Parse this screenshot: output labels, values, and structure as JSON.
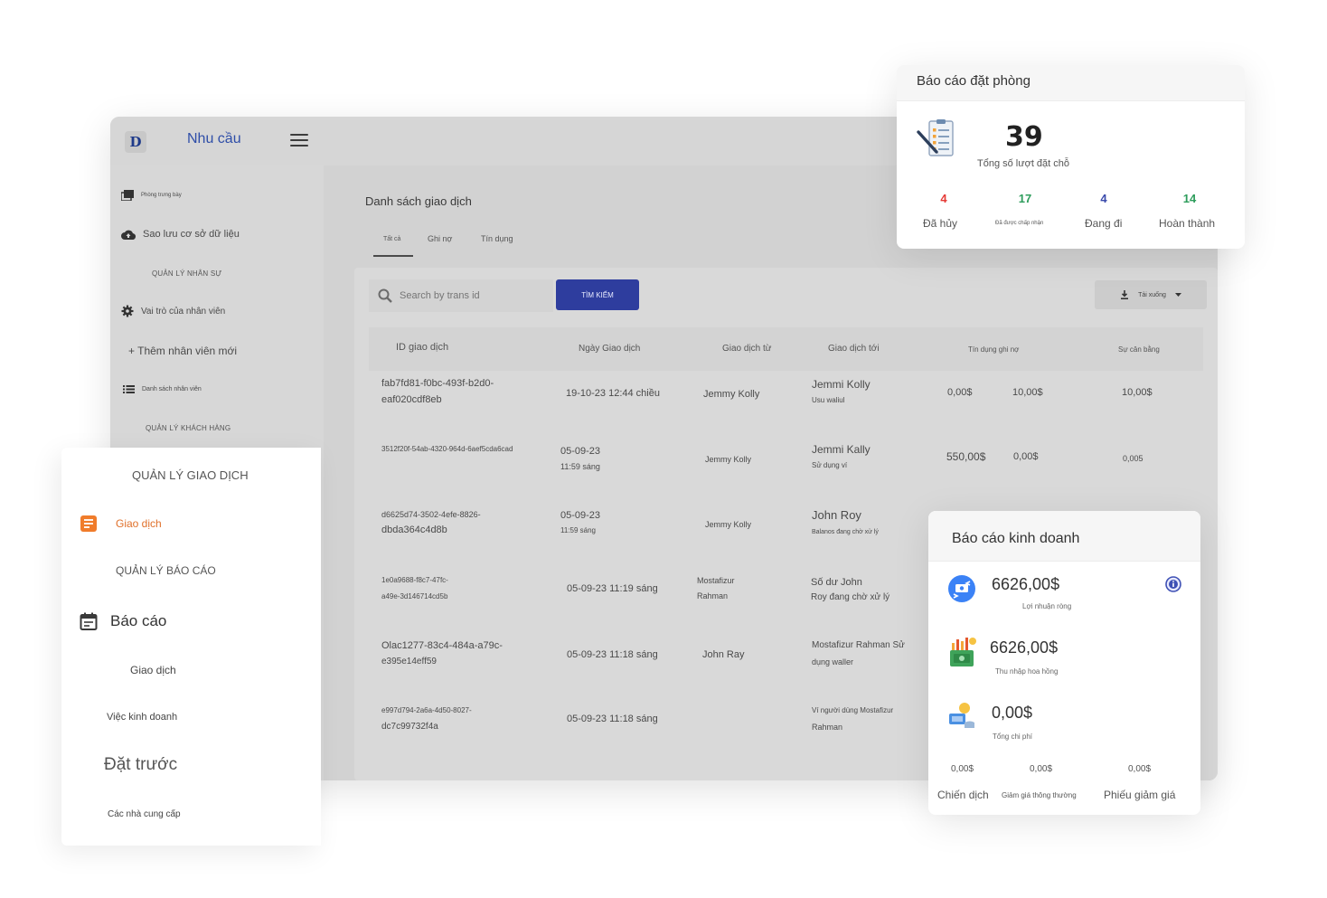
{
  "app": {
    "logo_letter": "D",
    "title": "Nhu cầu"
  },
  "sidebar": {
    "gallery": "Phòng trưng bày",
    "backup": "Sao lưu cơ sở dữ liệu",
    "hr_section": "QUẢN LÝ NHÂN SỰ",
    "roles": "Vai trò của nhân viên",
    "add_staff": "+ Thêm nhân viên mới",
    "staff_list": "Danh sách nhân viên",
    "customer_section": "QUẢN LÝ KHÁCH HÀNG"
  },
  "main": {
    "title": "Danh sách giao dịch",
    "tabs": [
      "Tất cả",
      "Ghi nợ",
      "Tín dụng"
    ],
    "search_placeholder": "Search by trans id",
    "search_button": "TÌM KIẾM",
    "download_button": "Tải xuống",
    "columns": [
      "ID giao dịch",
      "Ngày Giao dịch",
      "Giao dịch từ",
      "Giao dịch tới",
      "Tín dụng ghi nợ",
      "Sự cân bằng"
    ],
    "rows": [
      {
        "id1": "fab7fd81-f0bc-493f-b2d0-",
        "id2": "eaf020cdf8eb",
        "date1": "19-10-23 12:44 chiều",
        "date2": "",
        "from1": "Jemmy Kolly",
        "from2": "",
        "to1": "Jemmi Kolly",
        "to2": "Usu waliul",
        "credit": "0,00$",
        "debit": "10,00$",
        "balance": "10,00$"
      },
      {
        "id1": "3512f20f-54ab-4320-964d-6aef5cda6cad",
        "id2": "",
        "date1": "05-09-23",
        "date2": "11:59 sáng",
        "from1": "Jemmy Kolly",
        "from2": "",
        "to1": "Jemmi Kally",
        "to2": "Sử dụng ví",
        "credit": "550,00$",
        "debit": "0,00$",
        "balance": "0,005"
      },
      {
        "id1": "d6625d74-3502-4efe-8826-",
        "id2": "dbda364c4d8b",
        "date1": "05-09-23",
        "date2": "11:59 sáng",
        "from1": "Jemmy Kolly",
        "from2": "",
        "to1": "John Roy",
        "to2": "Balanos đang chờ xử lý",
        "credit": "",
        "debit": "",
        "balance": ""
      },
      {
        "id1": "1e0a9688-f8c7-47fc-",
        "id2": "a49e-3d146714cd5b",
        "date1": "05-09-23 11:19 sáng",
        "date2": "",
        "from1": "Mostafizur",
        "from2": "Rahman",
        "to1": "Số dư John",
        "to2": "Roy đang chờ xử lý",
        "credit": "",
        "debit": "",
        "balance": ""
      },
      {
        "id1": "Olac1277-83c4-484a-a79c-",
        "id2": "e395e14eff59",
        "date1": "05-09-23 11:18 sáng",
        "date2": "",
        "from1": "John Ray",
        "from2": "",
        "to1": "Mostafizur Rahman Sử",
        "to2": "dụng waller",
        "credit": "",
        "debit": "",
        "balance": ""
      },
      {
        "id1": "e997d794-2a6a-4d50-8027-",
        "id2": "dc7c99732f4a",
        "date1": "05-09-23 11:18 sáng",
        "date2": "",
        "from1": "",
        "from2": "",
        "to1": "Ví người dùng Mostafizur",
        "to2": "Rahman",
        "credit": "",
        "debit": "",
        "balance": ""
      }
    ]
  },
  "booking_report": {
    "title": "Báo cáo đặt phòng",
    "total": "39",
    "total_label": "Tổng số lượt đặt chỗ",
    "stats": [
      {
        "value": "4",
        "label": "Đã hủy",
        "color": "#e53935"
      },
      {
        "value": "17",
        "label": "Đã được chấp nhận",
        "color": "#2e9d5c"
      },
      {
        "value": "4",
        "label": "Đang đi",
        "color": "#3949ab"
      },
      {
        "value": "14",
        "label": "Hoàn thành",
        "color": "#2e9d5c"
      }
    ]
  },
  "transaction_panel": {
    "section_title": "QUẢN LÝ GIAO DỊCH",
    "active_item": "Giao dịch",
    "report_section": "QUẢN LÝ BÁO CÁO",
    "report_heading": "Báo cáo",
    "sub_transaction": "Giao dịch",
    "business": "Việc kinh doanh",
    "booking": "Đặt trước",
    "suppliers": "Các nhà cung cấp"
  },
  "business_report": {
    "title": "Báo cáo kinh doanh",
    "net_profit": "6626,00$",
    "net_profit_label": "Lợi nhuận ròng",
    "commission": "6626,00$",
    "commission_label": "Thu nhập hoa hồng",
    "expenses": "0,00$",
    "expenses_label": "Tổng chi phí",
    "footer_values": [
      "0,00$",
      "0,00$",
      "0,00$"
    ],
    "footer_labels": [
      "Chiến dịch",
      "Giảm giá thông thường",
      "Phiếu giảm giá"
    ]
  },
  "colors": {
    "accent_blue": "#2e3d9e",
    "orange": "#f07c2b",
    "card_bg": "#ffffff"
  }
}
